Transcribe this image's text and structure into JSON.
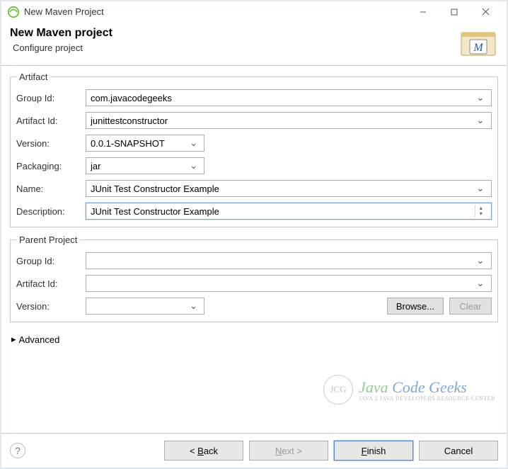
{
  "window_title": "New Maven Project",
  "header": {
    "title": "New Maven project",
    "subtitle": "Configure project",
    "maven_icon_letter": "M"
  },
  "artifact": {
    "legend": "Artifact",
    "group_id_label": "Group Id:",
    "group_id": "com.javacodegeeks",
    "artifact_id_label": "Artifact Id:",
    "artifact_id": "junittestconstructor",
    "version_label": "Version:",
    "version": "0.0.1-SNAPSHOT",
    "packaging_label": "Packaging:",
    "packaging": "jar",
    "name_label": "Name:",
    "name": "JUnit Test Constructor Example",
    "description_label": "Description:",
    "description": "JUnit Test Constructor Example"
  },
  "parent": {
    "legend": "Parent Project",
    "group_id_label": "Group Id:",
    "group_id": "",
    "artifact_id_label": "Artifact Id:",
    "artifact_id": "",
    "version_label": "Version:",
    "version": "",
    "browse_label": "Browse...",
    "clear_label": "Clear"
  },
  "advanced_label": "Advanced",
  "watermark": {
    "jcg": "JCG",
    "java": "Java ",
    "code": "Code ",
    "geeks": "Geeks",
    "tagline": "JAVA 2 JAVA DEVELOPERS RESOURCE CENTER"
  },
  "buttons": {
    "back": "< Back",
    "next": "Next >",
    "finish": "Finish",
    "cancel": "Cancel"
  }
}
